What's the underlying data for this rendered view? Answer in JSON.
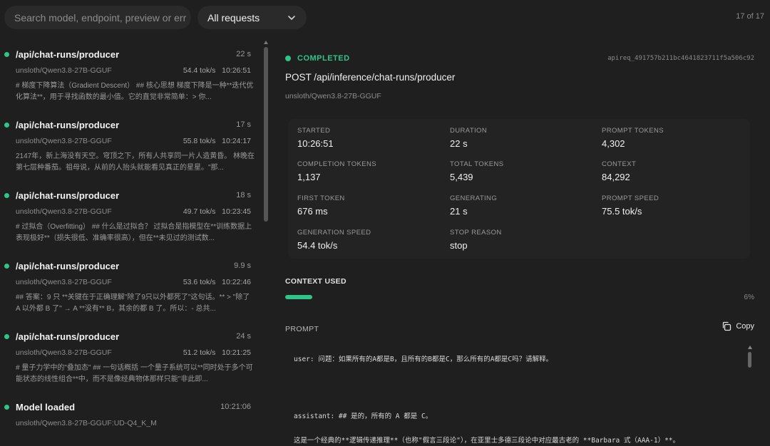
{
  "search": {
    "placeholder": "Search model, endpoint, preview or err"
  },
  "filter": {
    "selected": "All requests"
  },
  "counter": "17 of 17",
  "requests": [
    {
      "title": "/api/chat-runs/producer",
      "duration": "22 s",
      "model": "unsloth/Qwen3.8-27B-GGUF",
      "speed": "54.4 tok/s",
      "time": "10:26:51",
      "snippet": "# 梯度下降算法（Gradient Descent） ## 核心思想 梯度下降是一种**迭代优化算法**，用于寻找函数的最小值。它的直觉非常简单：> 你..."
    },
    {
      "title": "/api/chat-runs/producer",
      "duration": "17 s",
      "model": "unsloth/Qwen3.8-27B-GGUF",
      "speed": "55.8 tok/s",
      "time": "10:24:17",
      "snippet": "2147年，新上海没有天空。穹顶之下，所有人共享同一片人造黄昏。 林晚在第七层种番茄。祖母说，从前的人抬头就能看见真正的星星。\"那..."
    },
    {
      "title": "/api/chat-runs/producer",
      "duration": "18 s",
      "model": "unsloth/Qwen3.8-27B-GGUF",
      "speed": "49.7 tok/s",
      "time": "10:23:45",
      "snippet": "# 过拟合（Overfitting） ## 什么是过拟合？ 过拟合是指模型在**训练数据上表现极好**（损失很低、准确率很高），但在**未见过的测试数..."
    },
    {
      "title": "/api/chat-runs/producer",
      "duration": "9.9 s",
      "model": "unsloth/Qwen3.8-27B-GGUF",
      "speed": "53.6 tok/s",
      "time": "10:22:46",
      "snippet": "## 答案：9 只 **关键在于正确理解\"除了9只以外都死了\"这句话。** > \"除了 A 以外都 B 了\" → A **没有** B，其余的都 B 了。所以：- 总共..."
    },
    {
      "title": "/api/chat-runs/producer",
      "duration": "24 s",
      "model": "unsloth/Qwen3.8-27B-GGUF",
      "speed": "51.2 tok/s",
      "time": "10:21:25",
      "snippet": "# 量子力学中的\"叠加态\" ## 一句话概括 一个量子系统可以**同时处于多个可能状态的线性组合**中，而不是像经典物体那样只能\"非此即..."
    }
  ],
  "loaded": {
    "title": "Model loaded",
    "time": "10:21:06",
    "model": "unsloth/Qwen3.8-27B-GGUF:UD-Q4_K_M"
  },
  "detail": {
    "status": "COMPLETED",
    "request_id": "apireq_491757b211bc4641823711f5a506c92",
    "endpoint": "POST /api/inference/chat-runs/producer",
    "model": "unsloth/Qwen3.8-27B-GGUF",
    "stats": [
      {
        "label": "STARTED",
        "value": "10:26:51"
      },
      {
        "label": "DURATION",
        "value": "22 s"
      },
      {
        "label": "PROMPT TOKENS",
        "value": "4,302"
      },
      {
        "label": "COMPLETION TOKENS",
        "value": "1,137"
      },
      {
        "label": "TOTAL TOKENS",
        "value": "5,439"
      },
      {
        "label": "CONTEXT",
        "value": "84,292"
      },
      {
        "label": "FIRST TOKEN",
        "value": "676 ms"
      },
      {
        "label": "GENERATING",
        "value": "21 s"
      },
      {
        "label": "PROMPT SPEED",
        "value": "75.5 tok/s"
      },
      {
        "label": "GENERATION SPEED",
        "value": "54.4 tok/s"
      },
      {
        "label": "STOP REASON",
        "value": "stop"
      }
    ],
    "context_label": "CONTEXT USED",
    "context_pct": "6%",
    "context_fraction": 0.06,
    "prompt_label": "PROMPT",
    "copy_label": "Copy",
    "prompt_lines": [
      "user: 问题：如果所有的A都是B，且所有的B都是C，那么所有的A都是C吗？请解释。",
      "assistant: ## 是的，所有的 A 都是 C。",
      "这是一个经典的**逻辑传递推理**（也称\"假言三段论\"），在亚里士多德三段论中对应最古老的 **Barbara 式（AAA-1）**。"
    ]
  }
}
